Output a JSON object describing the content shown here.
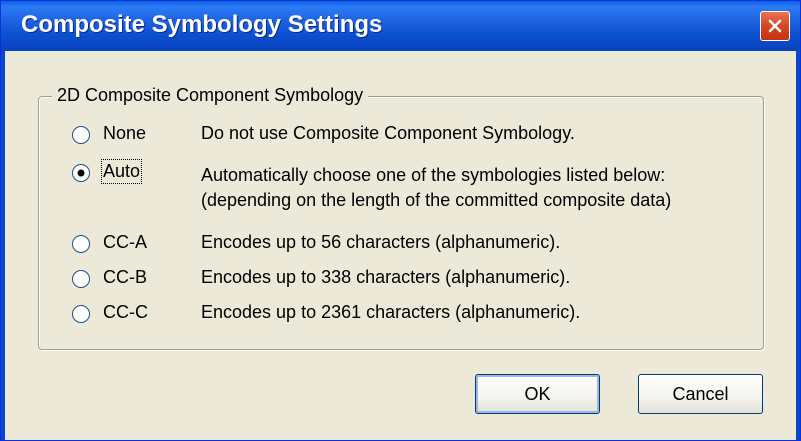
{
  "window": {
    "title": "Composite Symbology Settings",
    "close_icon": "close-icon"
  },
  "group": {
    "label": "2D Composite Component Symbology"
  },
  "options": [
    {
      "label": "None",
      "description": "Do not use Composite Component Symbology.",
      "selected": false
    },
    {
      "label": "Auto",
      "description": "Automatically choose one of the symbologies listed below:",
      "description2": "(depending on the length of the committed composite data)",
      "selected": true
    },
    {
      "label": "CC-A",
      "description": "Encodes up to 56 characters (alphanumeric).",
      "selected": false
    },
    {
      "label": "CC-B",
      "description": "Encodes up to 338 characters (alphanumeric).",
      "selected": false
    },
    {
      "label": "CC-C",
      "description": "Encodes up to 2361 characters (alphanumeric).",
      "selected": false
    }
  ],
  "buttons": {
    "ok": "OK",
    "cancel": "Cancel"
  },
  "colors": {
    "titlebar": "#0a4fd0",
    "dialog_bg": "#ece9d8",
    "close_button": "#d6461f"
  }
}
